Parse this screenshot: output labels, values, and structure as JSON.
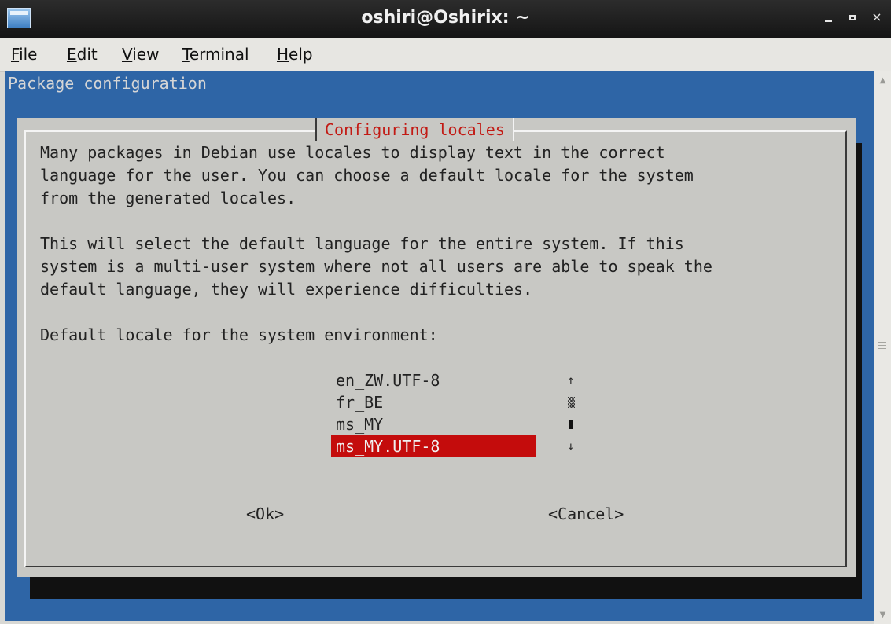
{
  "window": {
    "title": "oshiri@Oshirix: ~",
    "icon": "terminal-app-icon",
    "controls": [
      "minimize-icon",
      "maximize-icon",
      "close-icon"
    ],
    "close_glyph": "×"
  },
  "menubar": {
    "items": [
      {
        "mnemonic": "F",
        "rest": "ile"
      },
      {
        "mnemonic": "E",
        "rest": "dit"
      },
      {
        "mnemonic": "V",
        "rest": "iew"
      },
      {
        "mnemonic": "T",
        "rest": "erminal"
      },
      {
        "mnemonic": "H",
        "rest": "elp"
      }
    ]
  },
  "terminal": {
    "header": "Package configuration",
    "background_color": "#2e65a6",
    "dialog": {
      "title": "Configuring locales",
      "title_color": "#c21a14",
      "paragraph1": "Many packages in Debian use locales to display text in the correct\nlanguage for the user. You can choose a default locale for the system\nfrom the generated locales.",
      "paragraph2": "This will select the default language for the entire system. If this\nsystem is a multi-user system where not all users are able to speak the\ndefault language, they will experience difficulties.",
      "prompt": "Default locale for the system environment:",
      "locales": [
        "en_ZW.UTF-8",
        "fr_BE",
        "ms_MY",
        "ms_MY.UTF-8"
      ],
      "selected_locale": "ms_MY.UTF-8",
      "selection_color": "#c40c0c",
      "scroll_up": "↑",
      "scroll_down": "↓",
      "ok_button": "<Ok>",
      "cancel_button": "<Cancel>"
    }
  }
}
